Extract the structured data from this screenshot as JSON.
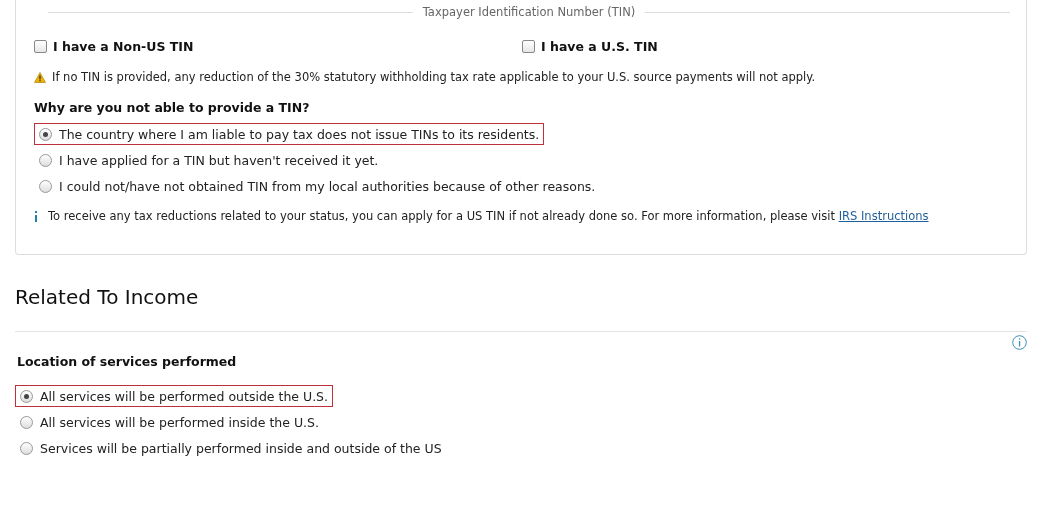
{
  "tin_section": {
    "legend": "Taxpayer Identification Number (TIN)",
    "checkboxes": [
      {
        "label": "I have a Non-US TIN",
        "checked": false
      },
      {
        "label": "I have a U.S. TIN",
        "checked": false
      }
    ],
    "warning": "If no TIN is provided, any reduction of the 30% statutory withholding tax rate applicable to your U.S. source payments will not apply.",
    "question": "Why are you not able to provide a TIN?",
    "options": [
      {
        "label": "The country where I am liable to pay tax does not issue TINs to its residents.",
        "selected": true,
        "highlighted": true
      },
      {
        "label": "I have applied for a TIN but haven't received it yet.",
        "selected": false,
        "highlighted": false
      },
      {
        "label": "I could not/have not obtained TIN from my local authorities because of other reasons.",
        "selected": false,
        "highlighted": false
      }
    ],
    "info": {
      "text": "To receive any tax reductions related to your status, you can apply for a US TIN if not already done so. For more information, please visit",
      "link": "IRS Instructions"
    }
  },
  "income_section": {
    "title": "Related To Income",
    "question": "Location of services performed",
    "options": [
      {
        "label": "All services will be performed outside the U.S.",
        "selected": true,
        "highlighted": true
      },
      {
        "label": "All services will be performed inside the U.S.",
        "selected": false,
        "highlighted": false
      },
      {
        "label": "Services will be partially performed inside and outside of the US",
        "selected": false,
        "highlighted": false
      }
    ]
  }
}
